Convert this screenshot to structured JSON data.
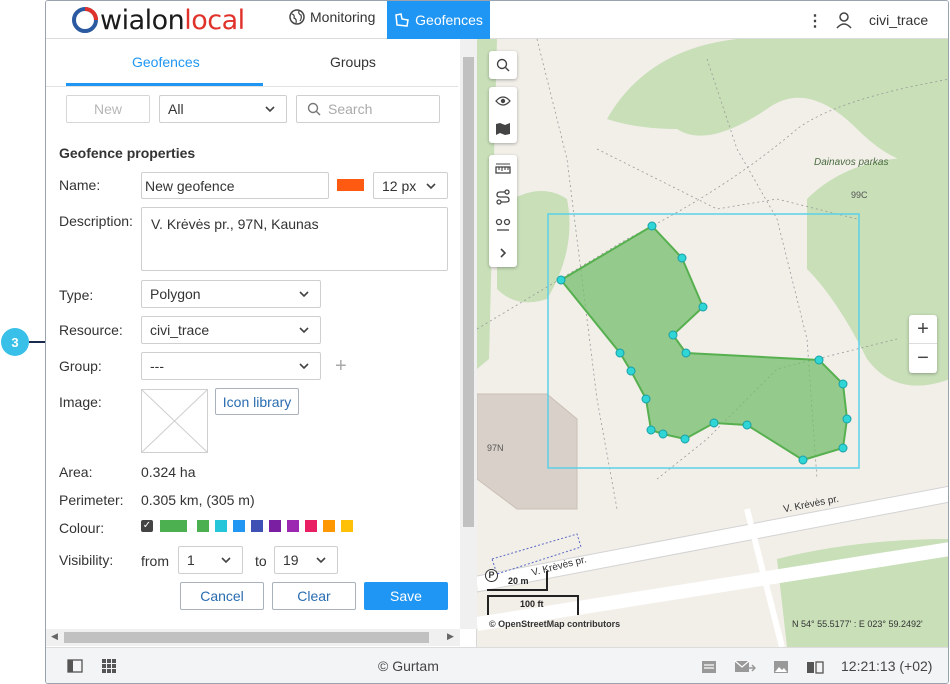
{
  "header": {
    "logo_text_a": "wialon",
    "logo_text_b": "local",
    "nav_monitoring": "Monitoring",
    "nav_geofences": "Geofences",
    "kebab": "⋮",
    "user_name": "civi_trace"
  },
  "tabs": {
    "geofences": "Geofences",
    "groups": "Groups"
  },
  "toolbar": {
    "new_button": "New",
    "filter_value": "All",
    "search_placeholder": "Search"
  },
  "form": {
    "section_title": "Geofence properties",
    "name_label": "Name:",
    "name_value": "New geofence",
    "line_width": "12 px",
    "line_color": "#ff5a12",
    "description_label": "Description:",
    "description_value": "V. Krėvės pr., 97N, Kaunas",
    "type_label": "Type:",
    "type_value": "Polygon",
    "resource_label": "Resource:",
    "resource_value": "civi_trace",
    "group_label": "Group:",
    "group_value": "---",
    "image_label": "Image:",
    "icon_library_button": "Icon library",
    "area_label": "Area:",
    "area_value": "0.324 ha",
    "perimeter_label": "Perimeter:",
    "perimeter_value": "0.305 km, (305 m)",
    "colour_label": "Colour:",
    "colours": [
      "#4caf50",
      "#4caf50",
      "#26c6da",
      "#2196f3",
      "#3f51b5",
      "#7b1fa2",
      "#9c27b0",
      "#e91e63",
      "#ff9800",
      "#ffc107"
    ],
    "visibility_label": "Visibility:",
    "from_label": "from",
    "from_value": "1",
    "to_label": "to",
    "to_value": "19",
    "cancel_button": "Cancel",
    "clear_button": "Clear",
    "save_button": "Save"
  },
  "map": {
    "park_label": "Dainavos parkas",
    "label_99c": "99C",
    "label_97n": "97N",
    "street_label_1": "V. Krėvės pr.",
    "street_label_2": "V. Krėvės pr.",
    "parking_glyph": "P",
    "scale_m": "20 m",
    "scale_ft": "100 ft",
    "attribution": "© OpenStreetMap contributors",
    "coordinates": "N 54° 55.5177' : E 023° 59.2492'",
    "zoom_in": "+",
    "zoom_out": "−"
  },
  "callout": {
    "number": "3"
  },
  "footer": {
    "copyright": "© Gurtam",
    "time": "12:21:13 (+02)"
  }
}
